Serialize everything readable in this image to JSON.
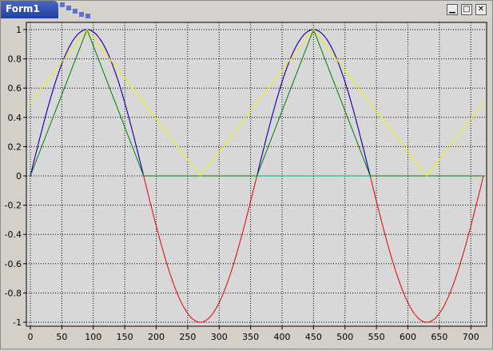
{
  "window": {
    "title": "Form1",
    "buttons": {
      "minimize": "▁",
      "maximize": "□",
      "close": "✕"
    }
  },
  "chart_data": {
    "type": "line",
    "title": "",
    "xlabel": "",
    "ylabel": "",
    "xlim": [
      0,
      720
    ],
    "ylim": [
      -1,
      1
    ],
    "grid": true,
    "x_ticks": [
      0,
      50,
      100,
      150,
      200,
      250,
      300,
      350,
      400,
      450,
      500,
      550,
      600,
      650,
      700
    ],
    "y_ticks": [
      1,
      0.8,
      0.6,
      0.4,
      0.2,
      0,
      -0.2,
      -0.4,
      -0.6,
      -0.8,
      -1
    ],
    "x_tick_labels": [
      "0",
      "50",
      "100",
      "150",
      "200",
      "250",
      "300",
      "350",
      "400",
      "450",
      "500",
      "550",
      "600",
      "650",
      "700"
    ],
    "y_tick_labels": [
      "1",
      "0.8",
      "0.6",
      "0.4",
      "0.2",
      "0",
      "-0.2",
      "-0.4",
      "-0.6",
      "-0.8",
      "-1"
    ],
    "series": [
      {
        "color": "#e00000",
        "x": [
          0,
          30,
          60,
          90,
          120,
          150,
          180,
          210,
          240,
          270,
          300,
          330,
          360,
          390,
          420,
          450,
          480,
          510,
          540,
          570,
          600,
          630,
          660,
          690,
          720
        ],
        "values": [
          0,
          0.5,
          0.866,
          1,
          0.866,
          0.5,
          0,
          -0.5,
          -0.866,
          -1,
          -0.866,
          -0.5,
          0,
          0.5,
          0.866,
          1,
          0.866,
          0.5,
          0,
          -0.5,
          -0.866,
          -1,
          -0.866,
          -0.5,
          0
        ]
      },
      {
        "color": "#0000cc",
        "x": [
          0,
          30,
          60,
          90,
          120,
          150,
          180,
          360,
          390,
          420,
          450,
          480,
          510,
          540,
          720
        ],
        "values": [
          0,
          0.5,
          0.866,
          1,
          0.866,
          0.5,
          0,
          0,
          0.5,
          0.866,
          1,
          0.866,
          0.5,
          0,
          0
        ]
      },
      {
        "color": "#00aa88",
        "x": [
          180,
          360,
          540,
          720
        ],
        "values": [
          0,
          0,
          0,
          0
        ]
      },
      {
        "color": "#007a00",
        "x": [
          0,
          90,
          180,
          360,
          450,
          540,
          720
        ],
        "values": [
          0,
          1,
          0,
          0,
          1,
          0,
          0
        ]
      },
      {
        "color": "#f0f000",
        "x": [
          0,
          90,
          270,
          450,
          630,
          720
        ],
        "values": [
          0.5,
          1,
          0,
          1,
          0,
          0.5
        ]
      }
    ]
  }
}
